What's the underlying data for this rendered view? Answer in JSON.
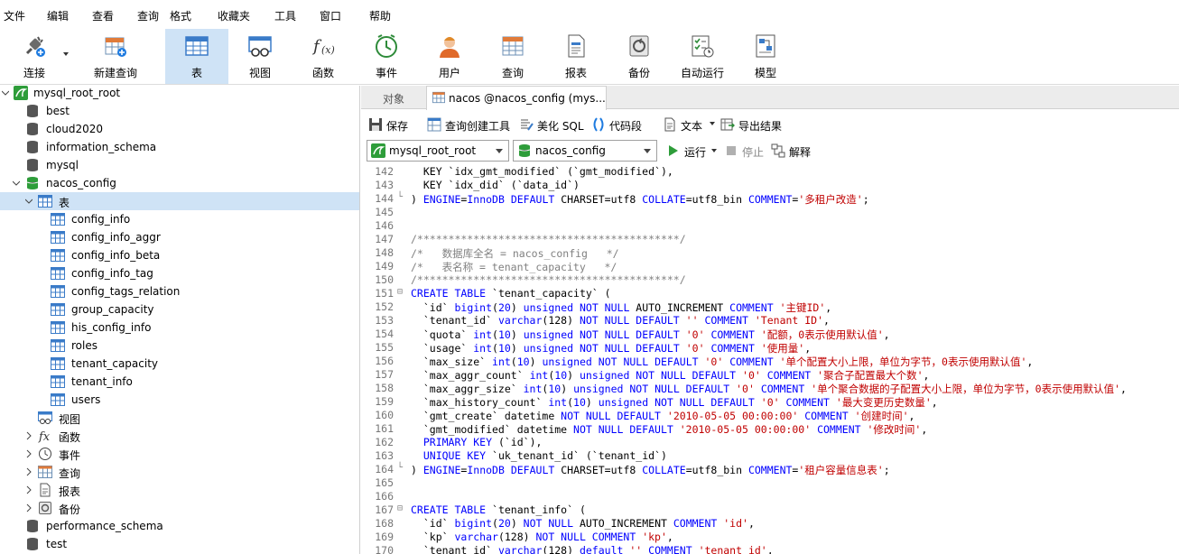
{
  "menu": [
    "文件",
    "编辑",
    "查看",
    "查询",
    "格式",
    "收藏夹",
    "工具",
    "窗口",
    "帮助"
  ],
  "toolbar": {
    "connect": "连接",
    "new_query": "新建查询",
    "table": "表",
    "view": "视图",
    "function": "函数",
    "event": "事件",
    "user": "用户",
    "query": "查询",
    "report": "报表",
    "backup": "备份",
    "auto_run": "自动运行",
    "model": "模型"
  },
  "tree": {
    "connection": "mysql_root_root",
    "dbs_top": [
      "best",
      "cloud2020",
      "information_schema",
      "mysql"
    ],
    "open_db": "nacos_config",
    "tables_node": "表",
    "tables": [
      "config_info",
      "config_info_aggr",
      "config_info_beta",
      "config_info_tag",
      "config_tags_relation",
      "group_capacity",
      "his_config_info",
      "roles",
      "tenant_capacity",
      "tenant_info",
      "users"
    ],
    "view": "视图",
    "function": "函数",
    "event": "事件",
    "query": "查询",
    "report": "报表",
    "backup": "备份",
    "dbs_bottom": [
      "performance_schema",
      "test"
    ]
  },
  "tabs": {
    "objects": "对象",
    "query_tab": "nacos @nacos_config (mys..."
  },
  "query_toolbar": {
    "save": "保存",
    "builder": "查询创建工具",
    "beautify": "美化 SQL",
    "snippet": "代码段",
    "text": "文本",
    "export": "导出结果"
  },
  "selectors": {
    "connection": "mysql_root_root",
    "database": "nacos_config",
    "run": "运行",
    "stop": "停止",
    "explain": "解释"
  },
  "code": {
    "lines": [
      {
        "n": "142",
        "fold": "",
        "parts": [
          [
            "p",
            "  KEY `idx_gmt_modified` (`gmt_modified`),"
          ]
        ]
      },
      {
        "n": "143",
        "fold": "",
        "parts": [
          [
            "p",
            "  KEY `idx_did` (`data_id`)"
          ]
        ]
      },
      {
        "n": "144",
        "fold": "└",
        "parts": [
          [
            "p",
            ") "
          ],
          [
            "k",
            "ENGINE"
          ],
          [
            "p",
            "="
          ],
          [
            "k",
            "InnoDB"
          ],
          [
            "p",
            " "
          ],
          [
            "k",
            "DEFAULT"
          ],
          [
            "p",
            " CHARSET=utf8 "
          ],
          [
            "k",
            "COLLATE"
          ],
          [
            "p",
            "=utf8_bin "
          ],
          [
            "k",
            "COMMENT"
          ],
          [
            "p",
            "="
          ],
          [
            "s",
            "'多租户改造'"
          ],
          [
            "p",
            ";"
          ]
        ]
      },
      {
        "n": "145",
        "fold": "",
        "parts": []
      },
      {
        "n": "146",
        "fold": "",
        "parts": []
      },
      {
        "n": "147",
        "fold": "",
        "parts": [
          [
            "c",
            "/******************************************/"
          ]
        ]
      },
      {
        "n": "148",
        "fold": "",
        "parts": [
          [
            "c",
            "/*   数据库全名 = nacos_config   */"
          ]
        ]
      },
      {
        "n": "149",
        "fold": "",
        "parts": [
          [
            "c",
            "/*   表名称 = tenant_capacity   */"
          ]
        ]
      },
      {
        "n": "150",
        "fold": "",
        "parts": [
          [
            "c",
            "/******************************************/"
          ]
        ]
      },
      {
        "n": "151",
        "fold": "⊟",
        "parts": [
          [
            "k",
            "CREATE TABLE"
          ],
          [
            "p",
            " `tenant_capacity` ("
          ]
        ]
      },
      {
        "n": "152",
        "fold": "",
        "parts": [
          [
            "p",
            "  `id` "
          ],
          [
            "k",
            "bigint"
          ],
          [
            "p",
            "("
          ],
          [
            "k",
            "20"
          ],
          [
            "p",
            ") "
          ],
          [
            "k",
            "unsigned NOT NULL"
          ],
          [
            "p",
            " AUTO_INCREMENT "
          ],
          [
            "k",
            "COMMENT"
          ],
          [
            "p",
            " "
          ],
          [
            "s",
            "'主键ID'"
          ],
          [
            "p",
            ","
          ]
        ]
      },
      {
        "n": "153",
        "fold": "",
        "parts": [
          [
            "p",
            "  `tenant_id` "
          ],
          [
            "k",
            "varchar"
          ],
          [
            "p",
            "(128) "
          ],
          [
            "k",
            "NOT NULL DEFAULT"
          ],
          [
            "p",
            " "
          ],
          [
            "s",
            "''"
          ],
          [
            "p",
            " "
          ],
          [
            "k",
            "COMMENT"
          ],
          [
            "p",
            " "
          ],
          [
            "s",
            "'Tenant ID'"
          ],
          [
            "p",
            ","
          ]
        ]
      },
      {
        "n": "154",
        "fold": "",
        "parts": [
          [
            "p",
            "  `quota` "
          ],
          [
            "k",
            "int"
          ],
          [
            "p",
            "("
          ],
          [
            "k",
            "10"
          ],
          [
            "p",
            ") "
          ],
          [
            "k",
            "unsigned NOT NULL DEFAULT"
          ],
          [
            "p",
            " "
          ],
          [
            "s",
            "'0'"
          ],
          [
            "p",
            " "
          ],
          [
            "k",
            "COMMENT"
          ],
          [
            "p",
            " "
          ],
          [
            "s",
            "'配额，0表示使用默认值'"
          ],
          [
            "p",
            ","
          ]
        ]
      },
      {
        "n": "155",
        "fold": "",
        "parts": [
          [
            "p",
            "  `usage` "
          ],
          [
            "k",
            "int"
          ],
          [
            "p",
            "("
          ],
          [
            "k",
            "10"
          ],
          [
            "p",
            ") "
          ],
          [
            "k",
            "unsigned NOT NULL DEFAULT"
          ],
          [
            "p",
            " "
          ],
          [
            "s",
            "'0'"
          ],
          [
            "p",
            " "
          ],
          [
            "k",
            "COMMENT"
          ],
          [
            "p",
            " "
          ],
          [
            "s",
            "'使用量'"
          ],
          [
            "p",
            ","
          ]
        ]
      },
      {
        "n": "156",
        "fold": "",
        "parts": [
          [
            "p",
            "  `max_size` "
          ],
          [
            "k",
            "int"
          ],
          [
            "p",
            "("
          ],
          [
            "k",
            "10"
          ],
          [
            "p",
            ") "
          ],
          [
            "k",
            "unsigned NOT NULL DEFAULT"
          ],
          [
            "p",
            " "
          ],
          [
            "s",
            "'0'"
          ],
          [
            "p",
            " "
          ],
          [
            "k",
            "COMMENT"
          ],
          [
            "p",
            " "
          ],
          [
            "s",
            "'单个配置大小上限，单位为字节，0表示使用默认值'"
          ],
          [
            "p",
            ","
          ]
        ]
      },
      {
        "n": "157",
        "fold": "",
        "parts": [
          [
            "p",
            "  `max_aggr_count` "
          ],
          [
            "k",
            "int"
          ],
          [
            "p",
            "("
          ],
          [
            "k",
            "10"
          ],
          [
            "p",
            ") "
          ],
          [
            "k",
            "unsigned NOT NULL DEFAULT"
          ],
          [
            "p",
            " "
          ],
          [
            "s",
            "'0'"
          ],
          [
            "p",
            " "
          ],
          [
            "k",
            "COMMENT"
          ],
          [
            "p",
            " "
          ],
          [
            "s",
            "'聚合子配置最大个数'"
          ],
          [
            "p",
            ","
          ]
        ]
      },
      {
        "n": "158",
        "fold": "",
        "parts": [
          [
            "p",
            "  `max_aggr_size` "
          ],
          [
            "k",
            "int"
          ],
          [
            "p",
            "("
          ],
          [
            "k",
            "10"
          ],
          [
            "p",
            ") "
          ],
          [
            "k",
            "unsigned NOT NULL DEFAULT"
          ],
          [
            "p",
            " "
          ],
          [
            "s",
            "'0'"
          ],
          [
            "p",
            " "
          ],
          [
            "k",
            "COMMENT"
          ],
          [
            "p",
            " "
          ],
          [
            "s",
            "'单个聚合数据的子配置大小上限，单位为字节，0表示使用默认值'"
          ],
          [
            "p",
            ","
          ]
        ]
      },
      {
        "n": "159",
        "fold": "",
        "parts": [
          [
            "p",
            "  `max_history_count` "
          ],
          [
            "k",
            "int"
          ],
          [
            "p",
            "("
          ],
          [
            "k",
            "10"
          ],
          [
            "p",
            ") "
          ],
          [
            "k",
            "unsigned NOT NULL DEFAULT"
          ],
          [
            "p",
            " "
          ],
          [
            "s",
            "'0'"
          ],
          [
            "p",
            " "
          ],
          [
            "k",
            "COMMENT"
          ],
          [
            "p",
            " "
          ],
          [
            "s",
            "'最大变更历史数量'"
          ],
          [
            "p",
            ","
          ]
        ]
      },
      {
        "n": "160",
        "fold": "",
        "parts": [
          [
            "p",
            "  `gmt_create` datetime "
          ],
          [
            "k",
            "NOT NULL DEFAULT"
          ],
          [
            "p",
            " "
          ],
          [
            "s",
            "'2010-05-05 00:00:00'"
          ],
          [
            "p",
            " "
          ],
          [
            "k",
            "COMMENT"
          ],
          [
            "p",
            " "
          ],
          [
            "s",
            "'创建时间'"
          ],
          [
            "p",
            ","
          ]
        ]
      },
      {
        "n": "161",
        "fold": "",
        "parts": [
          [
            "p",
            "  `gmt_modified` datetime "
          ],
          [
            "k",
            "NOT NULL DEFAULT"
          ],
          [
            "p",
            " "
          ],
          [
            "s",
            "'2010-05-05 00:00:00'"
          ],
          [
            "p",
            " "
          ],
          [
            "k",
            "COMMENT"
          ],
          [
            "p",
            " "
          ],
          [
            "s",
            "'修改时间'"
          ],
          [
            "p",
            ","
          ]
        ]
      },
      {
        "n": "162",
        "fold": "",
        "parts": [
          [
            "p",
            "  "
          ],
          [
            "k",
            "PRIMARY KEY"
          ],
          [
            "p",
            " (`id`),"
          ]
        ]
      },
      {
        "n": "163",
        "fold": "",
        "parts": [
          [
            "p",
            "  "
          ],
          [
            "k",
            "UNIQUE KEY"
          ],
          [
            "p",
            " `uk_tenant_id` (`tenant_id`)"
          ]
        ]
      },
      {
        "n": "164",
        "fold": "└",
        "parts": [
          [
            "p",
            ") "
          ],
          [
            "k",
            "ENGINE"
          ],
          [
            "p",
            "="
          ],
          [
            "k",
            "InnoDB"
          ],
          [
            "p",
            " "
          ],
          [
            "k",
            "DEFAULT"
          ],
          [
            "p",
            " CHARSET=utf8 "
          ],
          [
            "k",
            "COLLATE"
          ],
          [
            "p",
            "=utf8_bin "
          ],
          [
            "k",
            "COMMENT"
          ],
          [
            "p",
            "="
          ],
          [
            "s",
            "'租户容量信息表'"
          ],
          [
            "p",
            ";"
          ]
        ]
      },
      {
        "n": "165",
        "fold": "",
        "parts": []
      },
      {
        "n": "166",
        "fold": "",
        "parts": []
      },
      {
        "n": "167",
        "fold": "⊟",
        "parts": [
          [
            "k",
            "CREATE TABLE"
          ],
          [
            "p",
            " `tenant_info` ("
          ]
        ]
      },
      {
        "n": "168",
        "fold": "",
        "parts": [
          [
            "p",
            "  `id` "
          ],
          [
            "k",
            "bigint"
          ],
          [
            "p",
            "("
          ],
          [
            "k",
            "20"
          ],
          [
            "p",
            ") "
          ],
          [
            "k",
            "NOT NULL"
          ],
          [
            "p",
            " AUTO_INCREMENT "
          ],
          [
            "k",
            "COMMENT"
          ],
          [
            "p",
            " "
          ],
          [
            "s",
            "'id'"
          ],
          [
            "p",
            ","
          ]
        ]
      },
      {
        "n": "169",
        "fold": "",
        "parts": [
          [
            "p",
            "  `kp` "
          ],
          [
            "k",
            "varchar"
          ],
          [
            "p",
            "(128) "
          ],
          [
            "k",
            "NOT NULL COMMENT"
          ],
          [
            "p",
            " "
          ],
          [
            "s",
            "'kp'"
          ],
          [
            "p",
            ","
          ]
        ]
      },
      {
        "n": "170",
        "fold": "",
        "parts": [
          [
            "p",
            "  `tenant_id` "
          ],
          [
            "k",
            "varchar"
          ],
          [
            "p",
            "(128) "
          ],
          [
            "k",
            "default"
          ],
          [
            "p",
            " "
          ],
          [
            "s",
            "''"
          ],
          [
            "p",
            " "
          ],
          [
            "k",
            "COMMENT"
          ],
          [
            "p",
            " "
          ],
          [
            "s",
            "'tenant_id'"
          ],
          [
            "p",
            ","
          ]
        ]
      }
    ]
  },
  "colors": {
    "keyword": "#0000ff",
    "string": "#c00000",
    "comment": "#808080",
    "selection": "#cfe3f6"
  }
}
